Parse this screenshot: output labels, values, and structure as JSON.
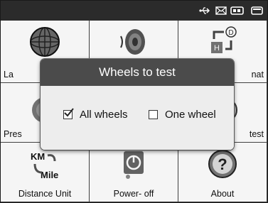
{
  "status_icons": [
    "usb-icon",
    "mail-icon",
    "battery-icon",
    "screen-icon"
  ],
  "menu": [
    {
      "label": "Language",
      "visible_label": "La",
      "icon": "globe-icon"
    },
    {
      "label": "Volume",
      "visible_label": "",
      "icon": "speaker-icon"
    },
    {
      "label": "Format",
      "visible_label": "nat",
      "icon": "units-icon"
    },
    {
      "label": "Pressure",
      "visible_label": "Pres",
      "icon": "pressure-icon"
    },
    {
      "label": "",
      "visible_label": "",
      "icon": ""
    },
    {
      "label": "Auto test",
      "visible_label": "test",
      "icon": "test-icon"
    },
    {
      "label": "Distance Unit",
      "visible_label": "Distance Unit",
      "icon": "km-mile-icon"
    },
    {
      "label": "Power- off",
      "visible_label": "Power- off",
      "icon": "power-icon"
    },
    {
      "label": "About",
      "visible_label": "About",
      "icon": "question-icon"
    }
  ],
  "dialog": {
    "title": "Wheels to test",
    "options": [
      {
        "label": "All wheels",
        "checked": true
      },
      {
        "label": "One wheel",
        "checked": false
      }
    ]
  },
  "km_label": "KM",
  "mile_label": "Mile"
}
